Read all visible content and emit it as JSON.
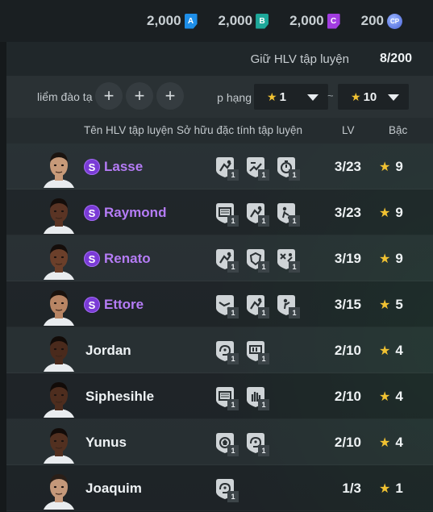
{
  "currencies": [
    {
      "value": "2,000",
      "badge": "A",
      "color": "#1e8ee8"
    },
    {
      "value": "2,000",
      "badge": "B",
      "color": "#1ea89a"
    },
    {
      "value": "2,000",
      "badge": "C",
      "color": "#a23ce0"
    },
    {
      "value": "200",
      "badge": "CP",
      "color": "#5a74e0"
    }
  ],
  "hold": {
    "label": "Giữ HLV tập luyện",
    "count": "8/200"
  },
  "filter": {
    "label": "liểm đào tạ",
    "rank_label": "p hạng",
    "min_value": "1",
    "separator": "~",
    "max_value": "10"
  },
  "columns": {
    "name": "Tên HLV tập luyện",
    "traits": "Sở hữu đặc tính tập luyện",
    "lv": "LV",
    "grade": "Bậc"
  },
  "coaches": [
    {
      "name": "Lasse",
      "elite": true,
      "badge": "S",
      "traits": [
        {
          "icon": "slide-tackle-icon",
          "level": "1"
        },
        {
          "icon": "sprint-icon",
          "level": "1"
        },
        {
          "icon": "stopwatch-icon",
          "level": "1"
        }
      ],
      "lv": "3/23",
      "grade": "9",
      "skin": "#c79a79",
      "hair": "#1b1410"
    },
    {
      "name": "Raymond",
      "elite": true,
      "badge": "S",
      "traits": [
        {
          "icon": "goal-icon",
          "level": "1"
        },
        {
          "icon": "slide-tackle-icon",
          "level": "1"
        },
        {
          "icon": "dribble-icon",
          "level": "1"
        }
      ],
      "lv": "3/23",
      "grade": "9",
      "skin": "#5a3424",
      "hair": "#140d0a"
    },
    {
      "name": "Renato",
      "elite": true,
      "badge": "S",
      "traits": [
        {
          "icon": "slide-tackle-icon",
          "level": "1"
        },
        {
          "icon": "shield-icon",
          "level": "1"
        },
        {
          "icon": "tactics-icon",
          "level": "1"
        }
      ],
      "lv": "3/19",
      "grade": "9",
      "skin": "#6b3f2a",
      "hair": "#140d0a"
    },
    {
      "name": "Ettore",
      "elite": true,
      "badge": "S",
      "traits": [
        {
          "icon": "kick-icon",
          "level": "1"
        },
        {
          "icon": "slide-tackle-icon",
          "level": "1"
        },
        {
          "icon": "shooting-icon",
          "level": "1"
        }
      ],
      "lv": "3/15",
      "grade": "5",
      "skin": "#b88564",
      "hair": "#1a120d"
    },
    {
      "name": "Jordan",
      "elite": false,
      "badge": "",
      "traits": [
        {
          "icon": "brain-icon",
          "level": "1"
        },
        {
          "icon": "stamina-icon",
          "level": "1"
        }
      ],
      "lv": "2/10",
      "grade": "4",
      "skin": "#4a2a1c",
      "hair": "#120b08"
    },
    {
      "name": "Siphesihle",
      "elite": false,
      "badge": "",
      "traits": [
        {
          "icon": "goal-icon",
          "level": "1"
        },
        {
          "icon": "glove-icon",
          "level": "1"
        }
      ],
      "lv": "2/10",
      "grade": "4",
      "skin": "#4e2d1e",
      "hair": "#120b08"
    },
    {
      "name": "Yunus",
      "elite": false,
      "badge": "",
      "traits": [
        {
          "icon": "ball-icon",
          "level": "1"
        },
        {
          "icon": "brain-icon",
          "level": "1"
        }
      ],
      "lv": "2/10",
      "grade": "4",
      "skin": "#523020",
      "hair": "#120b08"
    },
    {
      "name": "Joaquim",
      "elite": false,
      "badge": "",
      "traits": [
        {
          "icon": "brain-icon",
          "level": "1"
        }
      ],
      "lv": "1/3",
      "grade": "1",
      "skin": "#c4987a",
      "hair": "#2a1f18"
    }
  ]
}
